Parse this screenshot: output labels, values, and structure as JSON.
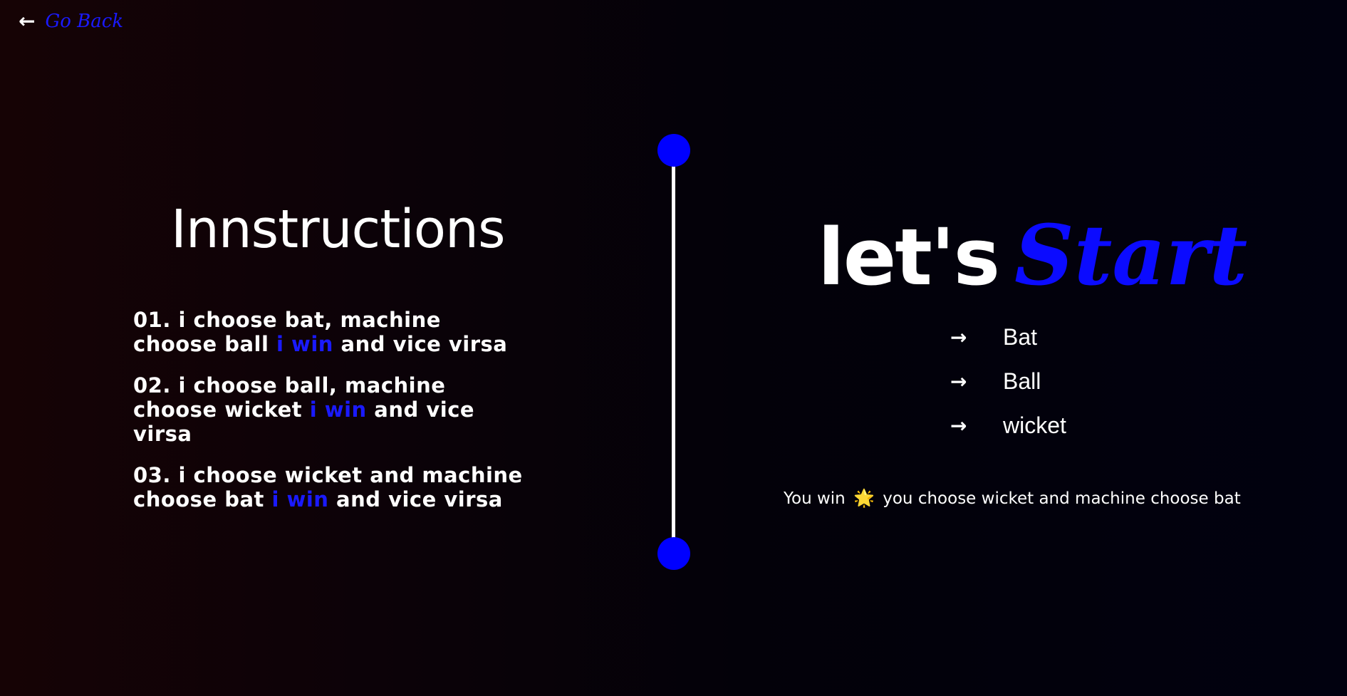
{
  "nav": {
    "back_icon": "←",
    "back_label": "Go Back"
  },
  "instructions": {
    "title": "Innstructions",
    "rules": [
      {
        "before": "01. i choose bat, machine choose ball ",
        "highlight": "i win",
        "after": " and vice virsa"
      },
      {
        "before": "02. i choose ball, machine choose wicket ",
        "highlight": "i win",
        "after": " and vice virsa"
      },
      {
        "before": "03. i choose wicket and machine choose bat ",
        "highlight": "i win",
        "after": " and vice virsa"
      }
    ]
  },
  "game": {
    "title_prefix": "let's",
    "title_accent": "Start",
    "options": [
      {
        "icon": "→",
        "label": "Bat"
      },
      {
        "icon": "→",
        "label": "Ball"
      },
      {
        "icon": "→",
        "label": "wicket"
      }
    ],
    "result": {
      "prefix": "You win",
      "emoji": "🌟",
      "suffix": "you choose wicket and machine choose bat"
    }
  },
  "colors": {
    "accent": "#0000ff",
    "text": "#ffffff",
    "background_left": "#160305",
    "background_right": "#01010f"
  }
}
